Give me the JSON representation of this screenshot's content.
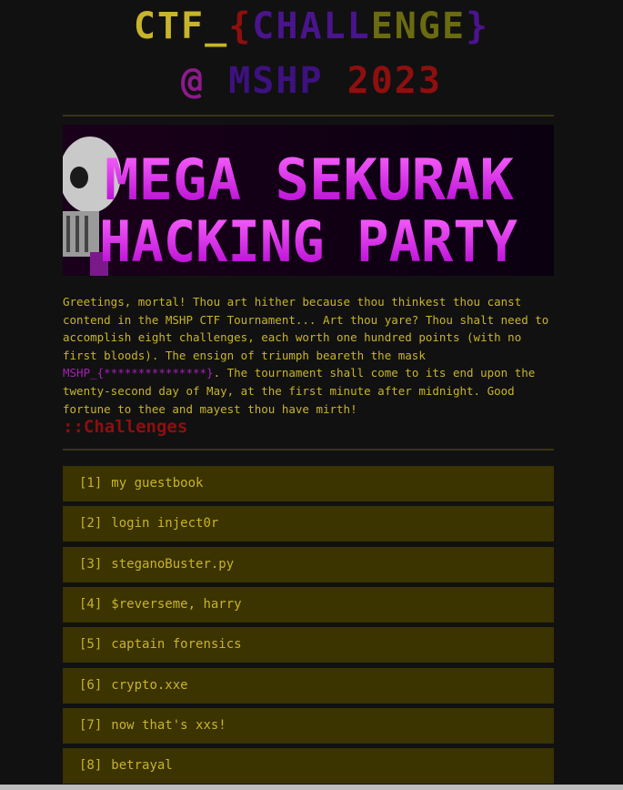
{
  "title": {
    "ctf": "CTF_",
    "brace_open": "{",
    "ch1": "CHALL",
    "ch2": "ENGE",
    "brace_close": "}",
    "at": "@",
    "mshp": "MSHP",
    "year": "2023"
  },
  "colors": {
    "yellow": "#c8b42a",
    "purple": "#4a148c",
    "red": "#8e0f0f",
    "magenta": "#a51fb8",
    "item_bg": "#3b3300"
  },
  "banner": {
    "line1": "MEGA SEKURAK",
    "line2": "HACKING PARTY"
  },
  "intro": {
    "text_before": "Greetings, mortal! Thou art hither because thou thinkest thou canst contend in the MSHP CTF Tournament... Art thou yare? Thou shalt need to accomplish eight challenges, each worth one hundred points (with no first bloods). The ensign of triumph beareth the mask ",
    "flag": "MSHP_{***************}",
    "text_after": ". The tournament shall come to its end upon the twenty-second day of May, at the first minute after midnight. Good fortune to thee and mayest thou have mirth!"
  },
  "section_heading": "::Challenges",
  "challenges": [
    {
      "index": "[1]",
      "name": "my guestbook"
    },
    {
      "index": "[2]",
      "name": "login inject0r"
    },
    {
      "index": "[3]",
      "name": "steganoBuster.py"
    },
    {
      "index": "[4]",
      "name": "$reverseme, harry"
    },
    {
      "index": "[5]",
      "name": "captain forensics"
    },
    {
      "index": "[6]",
      "name": "crypto.xxe"
    },
    {
      "index": "[7]",
      "name": "now that's xxs!"
    },
    {
      "index": "[8]",
      "name": "betrayal"
    }
  ]
}
